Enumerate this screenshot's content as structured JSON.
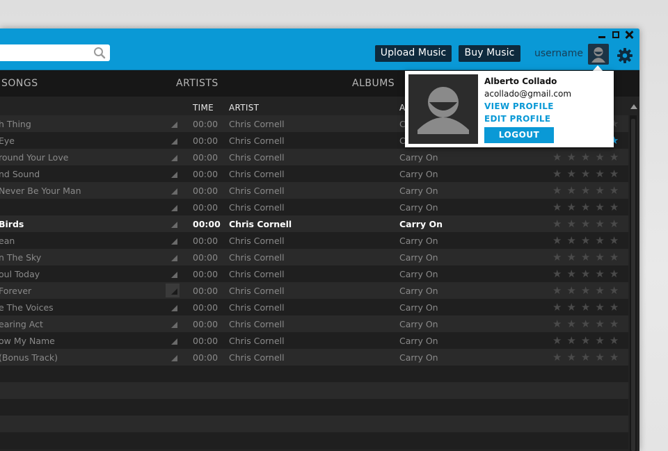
{
  "window": {
    "controls": [
      "minimize-icon",
      "maximize-icon",
      "close-icon"
    ]
  },
  "header": {
    "search_placeholder": "",
    "upload_label": "Upload Music",
    "buy_label": "Buy Music",
    "username": "username",
    "accent_color": "#0a99d6"
  },
  "tabs": [
    {
      "label": "SONGS"
    },
    {
      "label": "ARTISTS"
    },
    {
      "label": "ALBUMS"
    }
  ],
  "columns": {
    "time": "TIME",
    "artist": "ARTIST",
    "album": "A"
  },
  "songs": [
    {
      "title": "h Thing",
      "time": "00:00",
      "artist": "Chris Cornell",
      "album": "C",
      "rating": 0
    },
    {
      "title": "Eye",
      "time": "00:00",
      "artist": "Chris Cornell",
      "album": "C",
      "rating": 5
    },
    {
      "title": "round Your Love",
      "time": "00:00",
      "artist": "Chris Cornell",
      "album": "Carry On",
      "rating": 0
    },
    {
      "title": "nd Sound",
      "time": "00:00",
      "artist": "Chris Cornell",
      "album": "Carry On",
      "rating": 0
    },
    {
      "title": "Never Be Your Man",
      "time": "00:00",
      "artist": "Chris Cornell",
      "album": "Carry On",
      "rating": 0
    },
    {
      "title": "",
      "time": "00:00",
      "artist": "Chris Cornell",
      "album": "Carry On",
      "rating": 0
    },
    {
      "title": "Birds",
      "time": "00:00",
      "artist": "Chris Cornell",
      "album": "Carry On",
      "rating": 0,
      "active": true
    },
    {
      "title": "ean",
      "time": "00:00",
      "artist": "Chris Cornell",
      "album": "Carry On",
      "rating": 0
    },
    {
      "title": "n The Sky",
      "time": "00:00",
      "artist": "Chris Cornell",
      "album": "Carry On",
      "rating": 0
    },
    {
      "title": "oul Today",
      "time": "00:00",
      "artist": "Chris Cornell",
      "album": "Carry On",
      "rating": 0
    },
    {
      "title": "Forever",
      "time": "00:00",
      "artist": "Chris Cornell",
      "album": "Carry On",
      "rating": 0,
      "hovered": true
    },
    {
      "title": "e The Voices",
      "time": "00:00",
      "artist": "Chris Cornell",
      "album": "Carry On",
      "rating": 0
    },
    {
      "title": "earing Act",
      "time": "00:00",
      "artist": "Chris Cornell",
      "album": "Carry On",
      "rating": 0
    },
    {
      "title": "ow My Name",
      "time": "00:00",
      "artist": "Chris Cornell",
      "album": "Carry On",
      "rating": 0
    },
    {
      "title": "(Bonus Track)",
      "time": "00:00",
      "artist": "Chris Cornell",
      "album": "Carry On",
      "rating": 0
    }
  ],
  "profile_popup": {
    "name": "Alberto Collado",
    "email": "acollado@gmail.com",
    "view_profile": "VIEW PROFILE",
    "edit_profile": "EDIT PROFILE",
    "logout": "LOGOUT"
  }
}
